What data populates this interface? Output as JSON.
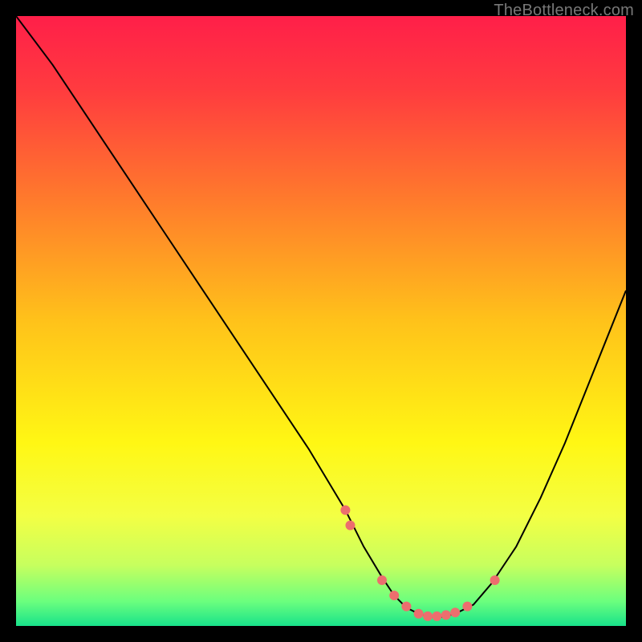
{
  "watermark": "TheBottleneck.com",
  "chart_data": {
    "type": "line",
    "title": "",
    "xlabel": "",
    "ylabel": "",
    "xlim": [
      0,
      100
    ],
    "ylim": [
      0,
      100
    ],
    "grid": false,
    "legend": false,
    "background_gradient": {
      "stops": [
        {
          "offset": 0.0,
          "color": "#ff1f49"
        },
        {
          "offset": 0.12,
          "color": "#ff3b3f"
        },
        {
          "offset": 0.3,
          "color": "#ff7a2c"
        },
        {
          "offset": 0.5,
          "color": "#ffc21a"
        },
        {
          "offset": 0.7,
          "color": "#fff714"
        },
        {
          "offset": 0.82,
          "color": "#f3ff44"
        },
        {
          "offset": 0.9,
          "color": "#c7ff5e"
        },
        {
          "offset": 0.96,
          "color": "#6bff7e"
        },
        {
          "offset": 1.0,
          "color": "#18e28a"
        }
      ]
    },
    "series": [
      {
        "name": "bottleneck-curve",
        "color": "#000000",
        "x": [
          0,
          6,
          12,
          18,
          24,
          30,
          36,
          42,
          48,
          54,
          57,
          60,
          62,
          64,
          66,
          68,
          70,
          72,
          75,
          78,
          82,
          86,
          90,
          94,
          98,
          100
        ],
        "y": [
          100,
          92,
          83,
          74,
          65,
          56,
          47,
          38,
          29,
          19,
          13,
          8,
          5,
          3,
          2,
          1.5,
          1.5,
          2,
          3.5,
          7,
          13,
          21,
          30,
          40,
          50,
          55
        ]
      }
    ],
    "markers": {
      "name": "highlight-points",
      "color": "#ec6e6e",
      "radius": 6,
      "x": [
        54,
        54.8,
        60,
        62,
        64,
        66,
        67.5,
        69,
        70.5,
        72,
        74,
        78.5
      ],
      "y": [
        19,
        16.5,
        7.5,
        5,
        3.2,
        2,
        1.6,
        1.6,
        1.8,
        2.2,
        3.2,
        7.5
      ]
    }
  }
}
